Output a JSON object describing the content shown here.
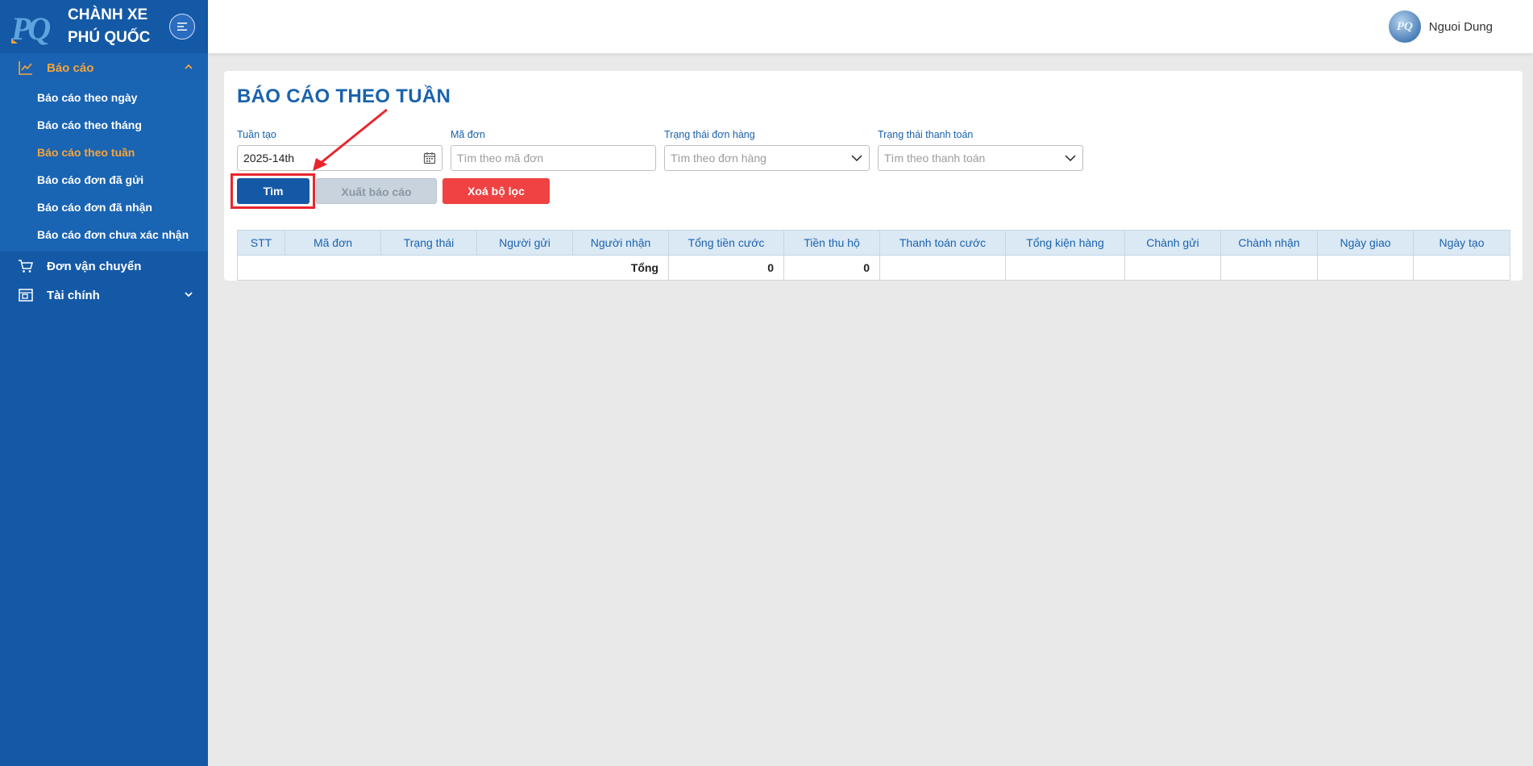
{
  "sidebar": {
    "brand_line1": "CHÀNH XE",
    "brand_line2": "PHÚ QUỐC",
    "logo_text": "PQ",
    "groups": [
      {
        "label": "Báo cáo",
        "icon": "line-chart-icon",
        "expanded": true,
        "items": [
          {
            "label": "Báo cáo theo ngày"
          },
          {
            "label": "Báo cáo theo tháng"
          },
          {
            "label": "Báo cáo theo tuần"
          },
          {
            "label": "Báo cáo đơn đã gửi"
          },
          {
            "label": "Báo cáo đơn đã nhận"
          },
          {
            "label": "Báo cáo đơn chưa xác nhận"
          }
        ]
      },
      {
        "label": "Đơn vận chuyển",
        "icon": "cart-icon"
      },
      {
        "label": "Tài chính",
        "icon": "wallet-icon",
        "expanded": false
      }
    ]
  },
  "topbar": {
    "user_name": "Nguoi Dung",
    "avatar_text": "PQ"
  },
  "main": {
    "title": "BÁO CÁO THEO TUẦN",
    "filters": {
      "week": {
        "label": "Tuần tạo",
        "value": "2025-14th"
      },
      "order_code": {
        "label": "Mã đơn",
        "placeholder": "Tìm theo mã đơn"
      },
      "order_status": {
        "label": "Trạng thái đơn hàng",
        "placeholder": "Tìm theo đơn hàng"
      },
      "payment_status": {
        "label": "Trạng thái thanh toán",
        "placeholder": "Tìm theo thanh toán"
      }
    },
    "buttons": {
      "search": "Tìm",
      "export": "Xuất báo cáo",
      "clear": "Xoá bộ lọc"
    },
    "table": {
      "columns": [
        "STT",
        "Mã đơn",
        "Trạng thái",
        "Người gửi",
        "Người nhận",
        "Tổng tiền cước",
        "Tiền thu hộ",
        "Thanh toán cước",
        "Tổng kiện hàng",
        "Chành gửi",
        "Chành nhận",
        "Ngày giao",
        "Ngày tạo"
      ],
      "total_label": "Tổng",
      "total_fee": "0",
      "total_cod": "0"
    }
  },
  "colors": {
    "sidebar": "#1459a6",
    "accent": "#f4a43c",
    "primary_text": "#1a62ad",
    "danger": "#f04242",
    "annotation": "#e8262d"
  }
}
